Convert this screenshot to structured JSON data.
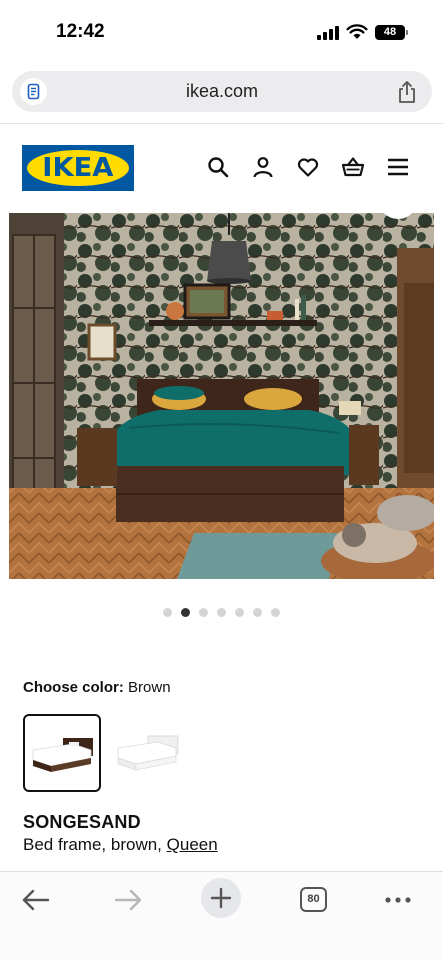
{
  "status_bar": {
    "time": "12:42",
    "battery": "48"
  },
  "browser": {
    "url": "ikea.com",
    "page_icon": "reader-page-icon",
    "share_icon": "share-icon",
    "tabs_count": "80"
  },
  "header": {
    "logo_text": "IKEA",
    "icons": [
      "search-icon",
      "account-icon",
      "heart-icon",
      "basket-icon",
      "menu-icon"
    ]
  },
  "carousel": {
    "count": 7,
    "active_index": 1
  },
  "product": {
    "choose_color_label": "Choose color:",
    "choose_color_value": "Brown",
    "name": "SONGESAND",
    "description": "Bed frame, brown,",
    "size_link": "Queen",
    "swatches": [
      "Brown",
      "White"
    ],
    "selected_swatch": "Brown"
  },
  "colors": {
    "ikea_blue": "#0058a3",
    "ikea_yellow": "#ffdb00",
    "bedding_teal": "#0f6e6a",
    "bed_brown": "#4a2e1f",
    "floor_wood": "#b0703d"
  }
}
